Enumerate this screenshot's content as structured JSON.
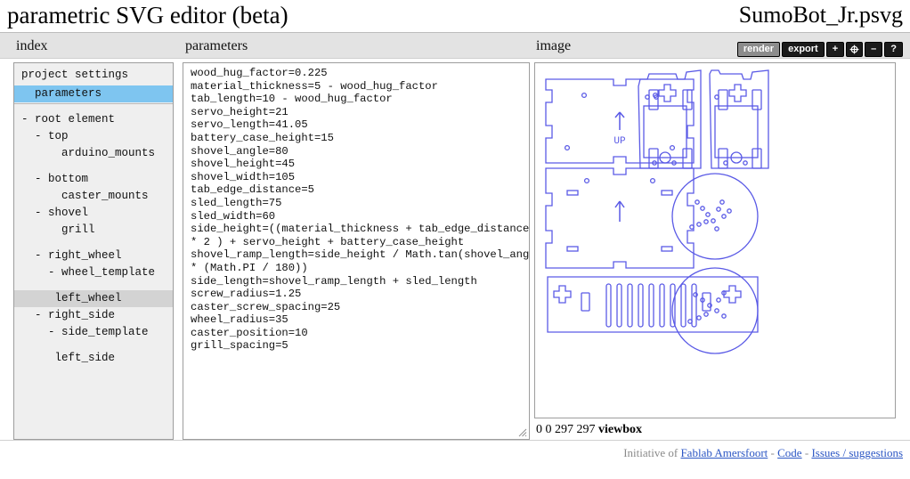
{
  "header": {
    "app_title": "parametric SVG editor (beta)",
    "doc_title": "SumoBot_Jr.psvg"
  },
  "columns": {
    "index_label": "index",
    "parameters_label": "parameters",
    "image_label": "image"
  },
  "toolbar": {
    "render_label": "render",
    "export_label": "export",
    "zoom_in_label": "+",
    "fit_label": "fit-icon",
    "zoom_out_label": "–",
    "help_label": "?"
  },
  "index": {
    "settings_header": "project settings",
    "settings_items": [
      {
        "label": "  parameters",
        "state": "selected"
      }
    ],
    "tree": [
      {
        "label": "- root element",
        "indent": 0,
        "state": "normal"
      },
      {
        "label": "  - top",
        "indent": 0,
        "state": "normal"
      },
      {
        "label": "      arduino_mounts",
        "indent": 0,
        "state": "normal"
      },
      {
        "label": "",
        "indent": 0,
        "state": "gap"
      },
      {
        "label": "  - bottom",
        "indent": 0,
        "state": "normal"
      },
      {
        "label": "      caster_mounts",
        "indent": 0,
        "state": "normal"
      },
      {
        "label": "  - shovel",
        "indent": 0,
        "state": "normal"
      },
      {
        "label": "      grill",
        "indent": 0,
        "state": "normal"
      },
      {
        "label": "",
        "indent": 0,
        "state": "gap"
      },
      {
        "label": "  - right_wheel",
        "indent": 0,
        "state": "normal"
      },
      {
        "label": "    - wheel_template",
        "indent": 0,
        "state": "normal"
      },
      {
        "label": "",
        "indent": 0,
        "state": "gap"
      },
      {
        "label": "     left_wheel",
        "indent": 0,
        "state": "hover"
      },
      {
        "label": "  - right_side",
        "indent": 0,
        "state": "normal"
      },
      {
        "label": "    - side_template",
        "indent": 0,
        "state": "normal"
      },
      {
        "label": "",
        "indent": 0,
        "state": "gap"
      },
      {
        "label": "     left_side",
        "indent": 0,
        "state": "normal"
      }
    ]
  },
  "parameters": {
    "lines": [
      "wood_hug_factor=0.225",
      "material_thickness=5 - wood_hug_factor",
      "tab_length=10 - wood_hug_factor",
      "servo_height=21",
      "servo_length=41.05",
      "battery_case_height=15",
      "shovel_angle=80",
      "shovel_height=45",
      "shovel_width=105",
      "tab_edge_distance=5",
      "sled_length=75",
      "sled_width=60",
      "side_height=((material_thickness + tab_edge_distance)",
      "* 2 ) + servo_height + battery_case_height",
      "shovel_ramp_length=side_height / Math.tan(shovel_angle",
      "* (Math.PI / 180))",
      "side_length=shovel_ramp_length + sled_length",
      "screw_radius=1.25",
      "caster_screw_spacing=25",
      "wheel_radius=35",
      "caster_position=10",
      "grill_spacing=5"
    ]
  },
  "image": {
    "viewbox_values": "0 0 297 297",
    "viewbox_label": "viewbox",
    "stroke_color": "#5a5ae6",
    "label_up": "UP"
  },
  "footer": {
    "prefix": "Initiative of",
    "link_fablab": "Fablab Amersfoort",
    "sep1": "-",
    "link_code": "Code",
    "sep2": "-",
    "link_issues": "Issues / suggestions"
  }
}
